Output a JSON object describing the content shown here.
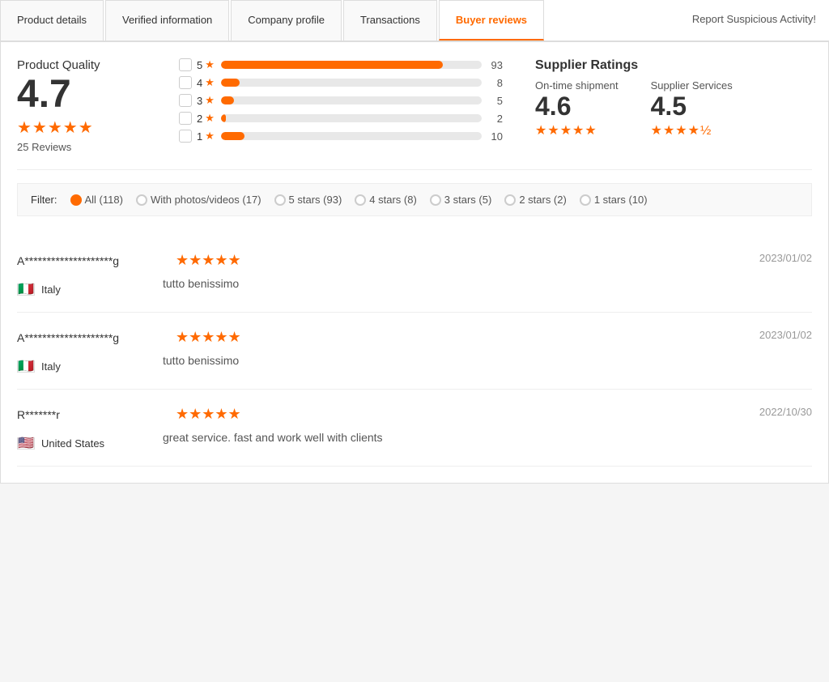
{
  "tabs": [
    {
      "id": "product-details",
      "label": "Product details",
      "active": false
    },
    {
      "id": "verified-information",
      "label": "Verified information",
      "active": false
    },
    {
      "id": "company-profile",
      "label": "Company profile",
      "active": false
    },
    {
      "id": "transactions",
      "label": "Transactions",
      "active": false
    },
    {
      "id": "buyer-reviews",
      "label": "Buyer reviews",
      "active": true
    }
  ],
  "report_button": "Report Suspicious Activity!",
  "product_quality": {
    "title": "Product Quality",
    "score": "4.7",
    "stars": "★★★★★",
    "reviews_label": "25 Reviews"
  },
  "bar_rows": [
    {
      "star": 5,
      "percent": 85,
      "count": 93
    },
    {
      "star": 4,
      "percent": 7,
      "count": 8
    },
    {
      "star": 3,
      "percent": 5,
      "count": 5
    },
    {
      "star": 2,
      "percent": 2,
      "count": 2
    },
    {
      "star": 1,
      "percent": 9,
      "count": 10
    }
  ],
  "supplier_ratings": {
    "title": "Supplier Ratings",
    "items": [
      {
        "label": "On-time shipment",
        "score": "4.6",
        "stars": "★★★★★"
      },
      {
        "label": "Supplier Services",
        "score": "4.5",
        "stars": "★★★★½"
      }
    ]
  },
  "filter": {
    "label": "Filter:",
    "options": [
      {
        "id": "all",
        "label": "All (118)",
        "selected": true
      },
      {
        "id": "photos",
        "label": "With photos/videos (17)",
        "selected": false
      },
      {
        "id": "5stars",
        "label": "5 stars (93)",
        "selected": false
      },
      {
        "id": "4stars",
        "label": "4 stars (8)",
        "selected": false
      },
      {
        "id": "3stars",
        "label": "3 stars (5)",
        "selected": false
      },
      {
        "id": "2stars",
        "label": "2 stars (2)",
        "selected": false
      },
      {
        "id": "1stars",
        "label": "1 stars (10)",
        "selected": false
      }
    ]
  },
  "reviews": [
    {
      "username": "A********************g",
      "stars": "★★★★★",
      "star_count": 5,
      "date": "2023/01/02",
      "country_flag": "🇮🇹",
      "country": "Italy",
      "text": "tutto benissimo"
    },
    {
      "username": "A********************g",
      "stars": "★★★★★",
      "star_count": 5,
      "date": "2023/01/02",
      "country_flag": "🇮🇹",
      "country": "Italy",
      "text": "tutto benissimo"
    },
    {
      "username": "R*******r",
      "stars": "★★★★★",
      "star_count": 5,
      "date": "2022/10/30",
      "country_flag": "🇺🇸",
      "country": "United States",
      "text": "great service. fast and work well with clients"
    }
  ]
}
